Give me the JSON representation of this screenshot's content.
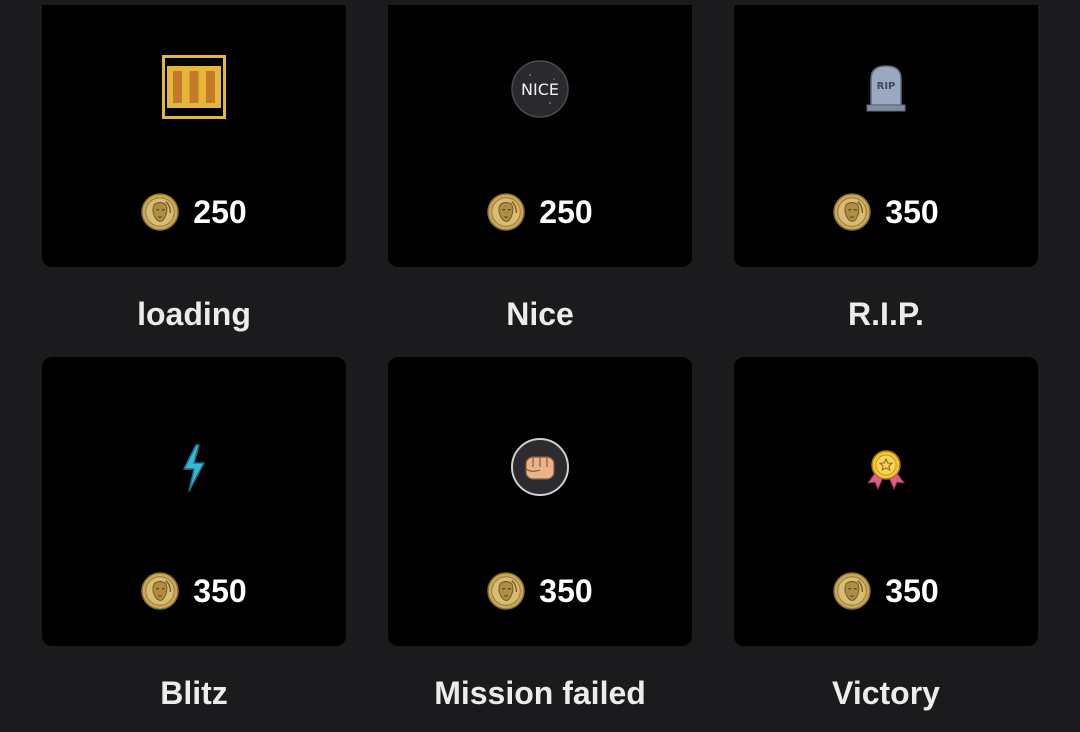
{
  "currency_icon": "coin-icon",
  "colors": {
    "page_bg": "#1b1b1e",
    "card_bg": "#000000",
    "text": "#ffffff"
  },
  "items": [
    {
      "label": "loading",
      "price": "250",
      "icon": "loading-bars-icon"
    },
    {
      "label": "Nice",
      "price": "250",
      "icon": "nice-badge-icon"
    },
    {
      "label": "R.I.P.",
      "price": "350",
      "icon": "rip-tombstone-icon"
    },
    {
      "label": "Blitz",
      "price": "350",
      "icon": "lightning-bolt-icon"
    },
    {
      "label": "Mission failed",
      "price": "350",
      "icon": "fist-icon"
    },
    {
      "label": "Victory",
      "price": "350",
      "icon": "medal-icon"
    }
  ]
}
